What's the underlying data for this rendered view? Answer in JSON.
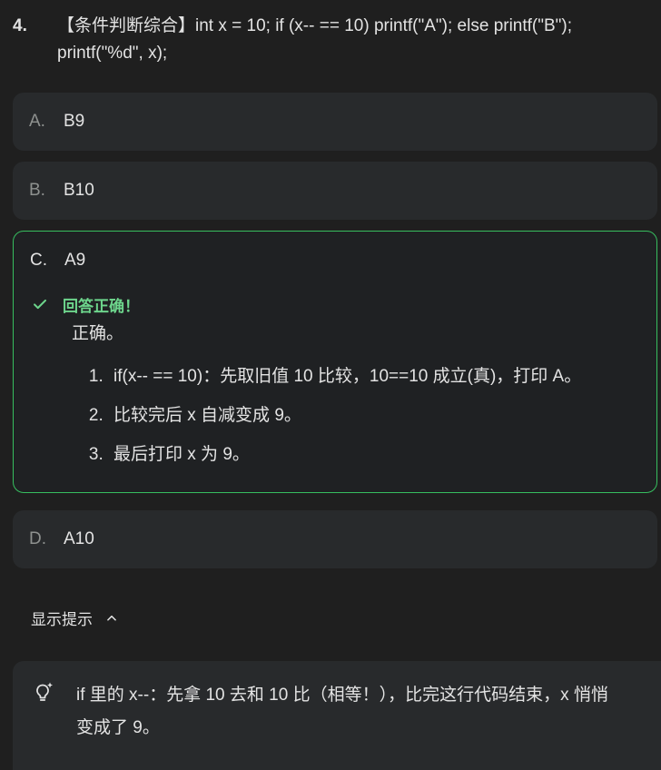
{
  "question": {
    "number": "4.",
    "text": "【条件判断综合】int x = 10; if (x-- == 10) printf(\"A\"); else printf(\"B\"); printf(\"%d\", x);"
  },
  "options": [
    {
      "letter": "A.",
      "text": "B9"
    },
    {
      "letter": "B.",
      "text": "B10"
    },
    {
      "letter": "C.",
      "text": "A9"
    },
    {
      "letter": "D.",
      "text": "A10"
    }
  ],
  "feedback": {
    "status": "回答正确！",
    "title": "正确。",
    "steps": [
      "if(x-- == 10)：先取旧值 10 比较，10==10 成立(真)，打印 A。",
      "比较完后 x 自减变成 9。",
      "最后打印 x 为 9。"
    ]
  },
  "hint": {
    "toggle_label": "显示提示",
    "text": "if 里的 x--：先拿 10 去和 10 比（相等！），比完这行代码结束，x 悄悄变成了 9。"
  },
  "colors": {
    "background": "#1f1f1f",
    "card": "#282a2c",
    "correct_border": "#37be5f",
    "correct_text": "#6dd58c"
  }
}
